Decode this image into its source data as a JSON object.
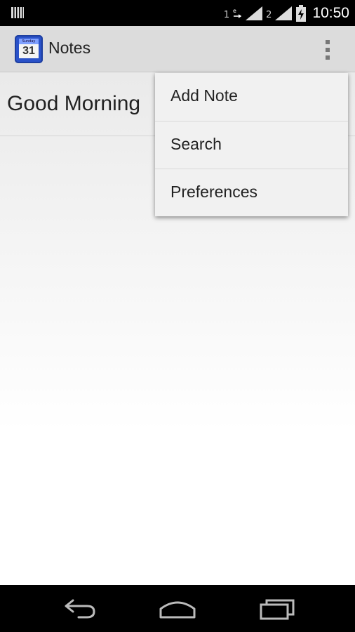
{
  "status_bar": {
    "sim1_label": "1",
    "sim2_label": "2",
    "time": "10:50",
    "icons": [
      "notification-icon",
      "sim1-signal-icon",
      "sim2-signal-icon",
      "battery-charging-icon"
    ]
  },
  "app_bar": {
    "title": "Notes",
    "icon_name": "calendar-app-icon",
    "icon_day": "31",
    "icon_weekday": "Sunday"
  },
  "notes": [
    {
      "title": "Good Morning"
    }
  ],
  "overflow_menu": {
    "items": [
      {
        "label": "Add Note"
      },
      {
        "label": "Search"
      },
      {
        "label": "Preferences"
      }
    ]
  },
  "nav_bar": {
    "buttons": [
      "back-icon",
      "home-icon",
      "recents-icon"
    ]
  },
  "colors": {
    "app_bar_bg": "#dcdcdc",
    "menu_bg": "#f1f1f1",
    "app_icon_blue": "#2a52c9"
  }
}
